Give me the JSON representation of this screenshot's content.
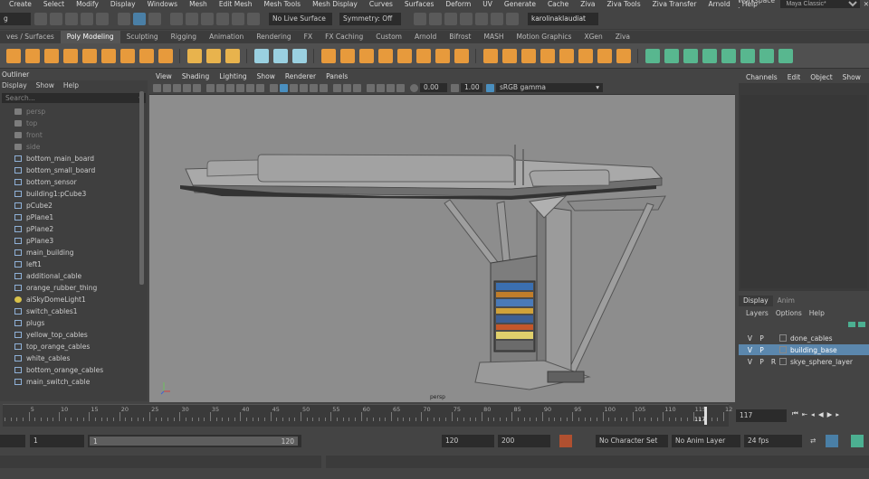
{
  "menubar": {
    "items": [
      "Create",
      "Select",
      "Modify",
      "Display",
      "Windows",
      "Mesh",
      "Edit Mesh",
      "Mesh Tools",
      "Mesh Display",
      "Curves",
      "Surfaces",
      "Deform",
      "UV",
      "Generate",
      "Cache",
      "Ziva",
      "Ziva Tools",
      "Ziva Transfer",
      "Arnold",
      "Help"
    ],
    "workspace_label": "Workspace :",
    "workspace_value": "Maya Classic*"
  },
  "statusline": {
    "mode_value": "g",
    "live_surface": "No Live Surface",
    "symmetry": "Symmetry: Off",
    "user": "karolinaklaudiat"
  },
  "shelf": {
    "tabs": [
      "ves / Surfaces",
      "Poly Modeling",
      "Sculpting",
      "Rigging",
      "Animation",
      "Rendering",
      "FX",
      "FX Caching",
      "Custom",
      "Arnold",
      "Bifrost",
      "MASH",
      "Motion Graphics",
      "XGen",
      "Ziva"
    ],
    "active_tab": "Poly Modeling",
    "icon_colors": [
      "#e79a3c",
      "#e79a3c",
      "#e79a3c",
      "#e79a3c",
      "#e79a3c",
      "#e79a3c",
      "#e79a3c",
      "#e79a3c",
      "#e79a3c",
      "#3a3a3a",
      "#e8b34d",
      "#e8b34d",
      "#e8b34d",
      "#3a3a3a",
      "#9ad0e0",
      "#9ad0e0",
      "#9ad0e0",
      "#3a3a3a",
      "#e79a3c",
      "#e79a3c",
      "#e79a3c",
      "#e79a3c",
      "#e79a3c",
      "#e79a3c",
      "#e79a3c",
      "#e79a3c",
      "#3a3a3a",
      "#e79a3c",
      "#e79a3c",
      "#e79a3c",
      "#e79a3c",
      "#e79a3c",
      "#e79a3c",
      "#e79a3c",
      "#e79a3c",
      "#3a3a3a",
      "#58b78f",
      "#58b78f",
      "#58b78f",
      "#58b78f",
      "#58b78f",
      "#58b78f",
      "#58b78f",
      "#58b78f"
    ]
  },
  "outliner": {
    "title": "Outliner",
    "menu": [
      "Display",
      "Show",
      "Help"
    ],
    "search_placeholder": "Search...",
    "items": [
      {
        "label": "persp",
        "dim": true,
        "icon": "camera"
      },
      {
        "label": "top",
        "dim": true,
        "icon": "camera"
      },
      {
        "label": "front",
        "dim": true,
        "icon": "camera"
      },
      {
        "label": "side",
        "dim": true,
        "icon": "camera"
      },
      {
        "label": "bottom_main_board",
        "dim": false,
        "icon": "mesh"
      },
      {
        "label": "bottom_small_board",
        "dim": false,
        "icon": "mesh"
      },
      {
        "label": "bottom_sensor",
        "dim": false,
        "icon": "mesh"
      },
      {
        "label": "building1:pCube3",
        "dim": false,
        "icon": "mesh"
      },
      {
        "label": "pCube2",
        "dim": false,
        "icon": "mesh"
      },
      {
        "label": "pPlane1",
        "dim": false,
        "icon": "mesh"
      },
      {
        "label": "pPlane2",
        "dim": false,
        "icon": "mesh"
      },
      {
        "label": "pPlane3",
        "dim": false,
        "icon": "mesh"
      },
      {
        "label": "main_building",
        "dim": false,
        "icon": "mesh"
      },
      {
        "label": "left1",
        "dim": false,
        "icon": "mesh"
      },
      {
        "label": "additional_cable",
        "dim": false,
        "icon": "mesh"
      },
      {
        "label": "orange_rubber_thing",
        "dim": false,
        "icon": "mesh"
      },
      {
        "label": "aiSkyDomeLight1",
        "dim": false,
        "icon": "light"
      },
      {
        "label": "switch_cables1",
        "dim": false,
        "icon": "mesh"
      },
      {
        "label": "plugs",
        "dim": false,
        "icon": "mesh"
      },
      {
        "label": "yellow_top_cables",
        "dim": false,
        "icon": "mesh"
      },
      {
        "label": "top_orange_cables",
        "dim": false,
        "icon": "mesh"
      },
      {
        "label": "white_cables",
        "dim": false,
        "icon": "mesh"
      },
      {
        "label": "bottom_orange_cables",
        "dim": false,
        "icon": "mesh"
      },
      {
        "label": "main_switch_cable",
        "dim": false,
        "icon": "mesh"
      }
    ]
  },
  "viewport": {
    "menu": [
      "View",
      "Shading",
      "Lighting",
      "Show",
      "Renderer",
      "Panels"
    ],
    "exposure": "0.00",
    "gamma": "1.00",
    "color_space": "sRGB gamma",
    "camera_label": "persp"
  },
  "channelbox": {
    "menu": [
      "Channels",
      "Edit",
      "Object",
      "Show"
    ]
  },
  "layers": {
    "tabs": [
      "Display",
      "Anim"
    ],
    "menu": [
      "Layers",
      "Options",
      "Help"
    ],
    "rows": [
      {
        "v": "V",
        "p": "P",
        "r": "",
        "name": "done_cables",
        "selected": false
      },
      {
        "v": "V",
        "p": "P",
        "r": "",
        "name": "building_base",
        "selected": true
      },
      {
        "v": "V",
        "p": "P",
        "r": "R",
        "name": "skye_sphere_layer",
        "selected": false
      }
    ]
  },
  "timeline": {
    "tick_labels": [
      "5",
      "10",
      "15",
      "20",
      "25",
      "30",
      "35",
      "40",
      "45",
      "50",
      "55",
      "60",
      "65",
      "70",
      "75",
      "80",
      "85",
      "90",
      "95",
      "100",
      "105",
      "110",
      "115",
      "12"
    ],
    "current_frame": "117",
    "current_frame_field": "117"
  },
  "range": {
    "start": "1",
    "inner_start": "1",
    "slider_start": "1",
    "slider_end": "120",
    "end": "120",
    "anim_end": "200",
    "character_set": "No Character Set",
    "anim_layer": "No Anim Layer",
    "fps": "24 fps"
  }
}
